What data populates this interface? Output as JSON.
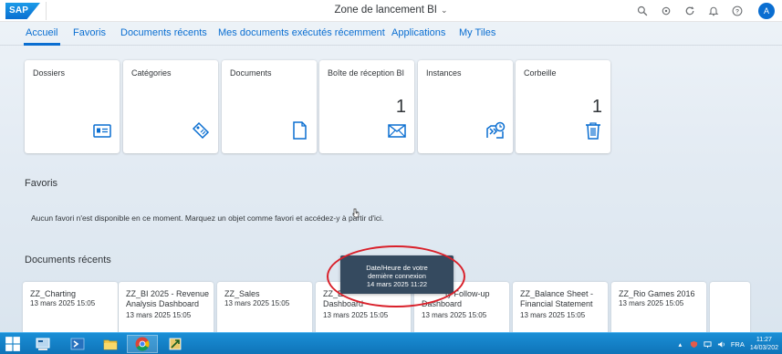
{
  "shell": {
    "logo_text": "SAP",
    "title": "Zone de lancement BI",
    "avatar_initial": "A"
  },
  "tabs": [
    {
      "label": "Accueil",
      "active": true
    },
    {
      "label": "Favoris"
    },
    {
      "label": "Documents récents"
    },
    {
      "label": "Mes documents exécutés récemment"
    },
    {
      "label": "Applications"
    },
    {
      "label": "My Tiles"
    }
  ],
  "tiles": [
    {
      "title": "Dossiers",
      "count": "",
      "icon": "folder-card-icon"
    },
    {
      "title": "Catégories",
      "count": "",
      "icon": "tag-icon"
    },
    {
      "title": "Documents",
      "count": "",
      "icon": "document-icon"
    },
    {
      "title": "Boîte de réception BI",
      "count": "1",
      "icon": "envelope-icon"
    },
    {
      "title": "Instances",
      "count": "",
      "icon": "instances-icon"
    },
    {
      "title": "Corbeille",
      "count": "1",
      "icon": "trash-icon"
    }
  ],
  "favorites": {
    "title": "Favoris",
    "empty_message": "Aucun favori n'est disponible en ce moment. Marquez un objet comme favori et accédez-y à partir d'ici."
  },
  "recent": {
    "title": "Documents récents",
    "documents": [
      {
        "title": "ZZ_Charting",
        "date": "13 mars 2025 15:05"
      },
      {
        "title": "ZZ_BI 2025 - Revenue Analysis Dashboard",
        "date": "13 mars 2025 15:05"
      },
      {
        "title": "ZZ_Sales",
        "date": "13 mars 2025 15:05"
      },
      {
        "title": "ZZ_E",
        "title_2": "Dashboard",
        "date": "13 mars 2025 15:05"
      },
      {
        "title": "ty Follow-up",
        "title_2": "Dashboard",
        "date": "13 mars 2025 15:05"
      },
      {
        "title": "ZZ_Balance Sheet - Financial Statement",
        "date": "13 mars 2025 15:05"
      },
      {
        "title": "ZZ_Rio Games 2016",
        "date": "13 mars 2025 15:05"
      }
    ]
  },
  "tooltip": {
    "line1": "Date/Heure de votre",
    "line2": "dernière connexion",
    "line3": "14 mars 2025 11:22"
  },
  "taskbar": {
    "language": "FRA",
    "time": "11:27",
    "date": "14/03/202"
  },
  "colors": {
    "accent": "#0a6ed1",
    "tooltip_bg": "#354a5f",
    "highlight": "#d9202a",
    "taskbar": "#1a8fd6"
  }
}
